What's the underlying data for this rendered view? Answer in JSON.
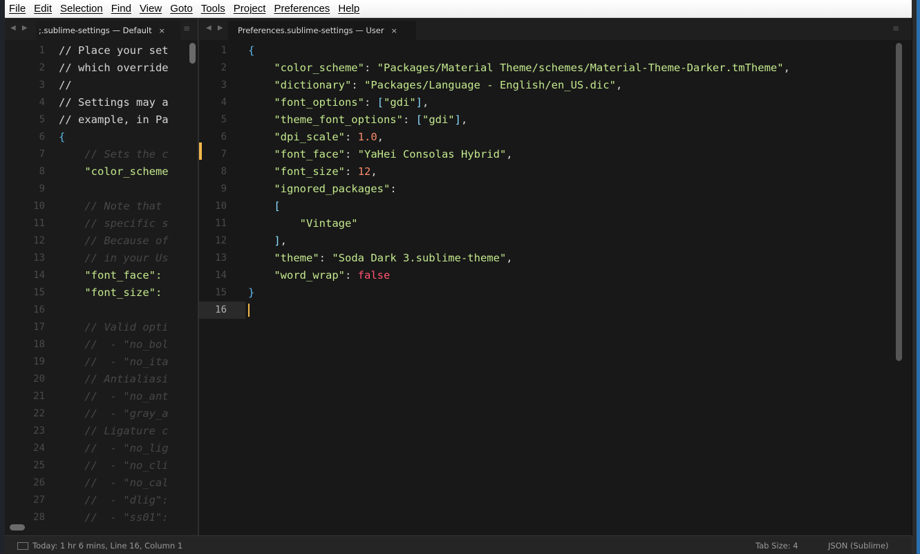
{
  "menu": [
    "File",
    "Edit",
    "Selection",
    "Find",
    "View",
    "Goto",
    "Tools",
    "Project",
    "Preferences",
    "Help"
  ],
  "tabs": {
    "left": {
      "label": ";.sublime-settings — Default",
      "close": "×",
      "arrows": "◀ ▶",
      "group_menu": "≡"
    },
    "right": {
      "label": "Preferences.sublime-settings — User",
      "close": "×",
      "arrows": "◀ ▶",
      "group_menu": "≡"
    }
  },
  "left_pane": {
    "lines": [
      {
        "n": "1",
        "t": "// Place your set",
        "s": "text"
      },
      {
        "n": "2",
        "t": "// which override",
        "s": "text"
      },
      {
        "n": "3",
        "t": "//",
        "s": "text"
      },
      {
        "n": "4",
        "t": "// Settings may a",
        "s": "text"
      },
      {
        "n": "5",
        "t": "// example, in Pa",
        "s": "text"
      },
      {
        "n": "6",
        "t": "{",
        "s": "brace"
      },
      {
        "n": "7",
        "t": "    // Sets the c",
        "s": "comment"
      },
      {
        "n": "8",
        "t": "    \"color_scheme",
        "s": "key"
      },
      {
        "n": "9",
        "t": "",
        "s": "text"
      },
      {
        "n": "10",
        "t": "    // Note that",
        "s": "comment"
      },
      {
        "n": "11",
        "t": "    // specific s",
        "s": "comment"
      },
      {
        "n": "12",
        "t": "    // Because of",
        "s": "comment"
      },
      {
        "n": "13",
        "t": "    // in your Us",
        "s": "comment"
      },
      {
        "n": "14",
        "t": "    \"font_face\":",
        "s": "key"
      },
      {
        "n": "15",
        "t": "    \"font_size\":",
        "s": "key"
      },
      {
        "n": "16",
        "t": "",
        "s": "text"
      },
      {
        "n": "17",
        "t": "    // Valid opti",
        "s": "comment"
      },
      {
        "n": "18",
        "t": "    //  - \"no_bol",
        "s": "comment"
      },
      {
        "n": "19",
        "t": "    //  - \"no_ita",
        "s": "comment"
      },
      {
        "n": "20",
        "t": "    // Antialiasi",
        "s": "comment"
      },
      {
        "n": "21",
        "t": "    //  - \"no_ant",
        "s": "comment"
      },
      {
        "n": "22",
        "t": "    //  - \"gray_a",
        "s": "comment"
      },
      {
        "n": "23",
        "t": "    // Ligature c",
        "s": "comment"
      },
      {
        "n": "24",
        "t": "    //  - \"no_lig",
        "s": "comment"
      },
      {
        "n": "25",
        "t": "    //  - \"no_cli",
        "s": "comment"
      },
      {
        "n": "26",
        "t": "    //  - \"no_cal",
        "s": "comment"
      },
      {
        "n": "27",
        "t": "    //  - \"dlig\":",
        "s": "comment"
      },
      {
        "n": "28",
        "t": "    //  - \"ss01\":",
        "s": "comment"
      }
    ]
  },
  "right_pane": {
    "lines": [
      {
        "n": "1",
        "parts": [
          [
            "{",
            "brace"
          ]
        ]
      },
      {
        "n": "2",
        "parts": [
          [
            "    \"color_scheme\"",
            "key"
          ],
          [
            ": ",
            "text"
          ],
          [
            "\"Packages/Material Theme/schemes/Material-Theme-Darker.tmTheme\"",
            "str"
          ],
          [
            ",",
            "text"
          ]
        ]
      },
      {
        "n": "3",
        "parts": [
          [
            "    \"dictionary\"",
            "key"
          ],
          [
            ": ",
            "text"
          ],
          [
            "\"Packages/Language - English/en_US.dic\"",
            "str"
          ],
          [
            ",",
            "text"
          ]
        ]
      },
      {
        "n": "4",
        "parts": [
          [
            "    \"font_options\"",
            "key"
          ],
          [
            ": ",
            "text"
          ],
          [
            "[",
            "punc"
          ],
          [
            "\"gdi\"",
            "str"
          ],
          [
            "]",
            "punc"
          ],
          [
            ",",
            "text"
          ]
        ]
      },
      {
        "n": "5",
        "parts": [
          [
            "    \"theme_font_options\"",
            "key"
          ],
          [
            ": ",
            "text"
          ],
          [
            "[",
            "punc"
          ],
          [
            "\"gdi\"",
            "str"
          ],
          [
            "]",
            "punc"
          ],
          [
            ",",
            "text"
          ]
        ]
      },
      {
        "n": "6",
        "parts": [
          [
            "    \"dpi_scale\"",
            "key"
          ],
          [
            ": ",
            "text"
          ],
          [
            "1.0",
            "num"
          ],
          [
            ",",
            "text"
          ]
        ]
      },
      {
        "n": "7",
        "parts": [
          [
            "    \"font_face\"",
            "key"
          ],
          [
            ": ",
            "text"
          ],
          [
            "\"YaHei Consolas Hybrid\"",
            "str"
          ],
          [
            ",",
            "text"
          ]
        ]
      },
      {
        "n": "8",
        "parts": [
          [
            "    \"font_size\"",
            "key"
          ],
          [
            ": ",
            "text"
          ],
          [
            "12",
            "num"
          ],
          [
            ",",
            "text"
          ]
        ]
      },
      {
        "n": "9",
        "parts": [
          [
            "    \"ignored_packages\"",
            "key"
          ],
          [
            ":",
            "text"
          ]
        ]
      },
      {
        "n": "10",
        "parts": [
          [
            "    [",
            "punc"
          ]
        ]
      },
      {
        "n": "11",
        "parts": [
          [
            "        \"Vintage\"",
            "str"
          ]
        ]
      },
      {
        "n": "12",
        "parts": [
          [
            "    ]",
            "punc"
          ],
          [
            ",",
            "text"
          ]
        ]
      },
      {
        "n": "13",
        "parts": [
          [
            "    \"theme\"",
            "key"
          ],
          [
            ": ",
            "text"
          ],
          [
            "\"Soda Dark 3.sublime-theme\"",
            "str"
          ],
          [
            ",",
            "text"
          ]
        ]
      },
      {
        "n": "14",
        "parts": [
          [
            "    \"word_wrap\"",
            "key"
          ],
          [
            ": ",
            "text"
          ],
          [
            "false",
            "bool"
          ]
        ]
      },
      {
        "n": "15",
        "parts": [
          [
            "}",
            "brace"
          ]
        ]
      },
      {
        "n": "16",
        "parts": [],
        "current": true
      }
    ]
  },
  "status": {
    "left": "Today: 1 hr 6 mins, Line 16, Column 1",
    "tab_size": "Tab Size: 4",
    "syntax": "JSON (Sublime)"
  },
  "colors": {
    "key": "#c3e88d",
    "string": "#c3e88d",
    "number": "#f78c6c",
    "boolean": "#ff5370",
    "brace": "#5eb6e8",
    "caret": "#f2b84b"
  }
}
